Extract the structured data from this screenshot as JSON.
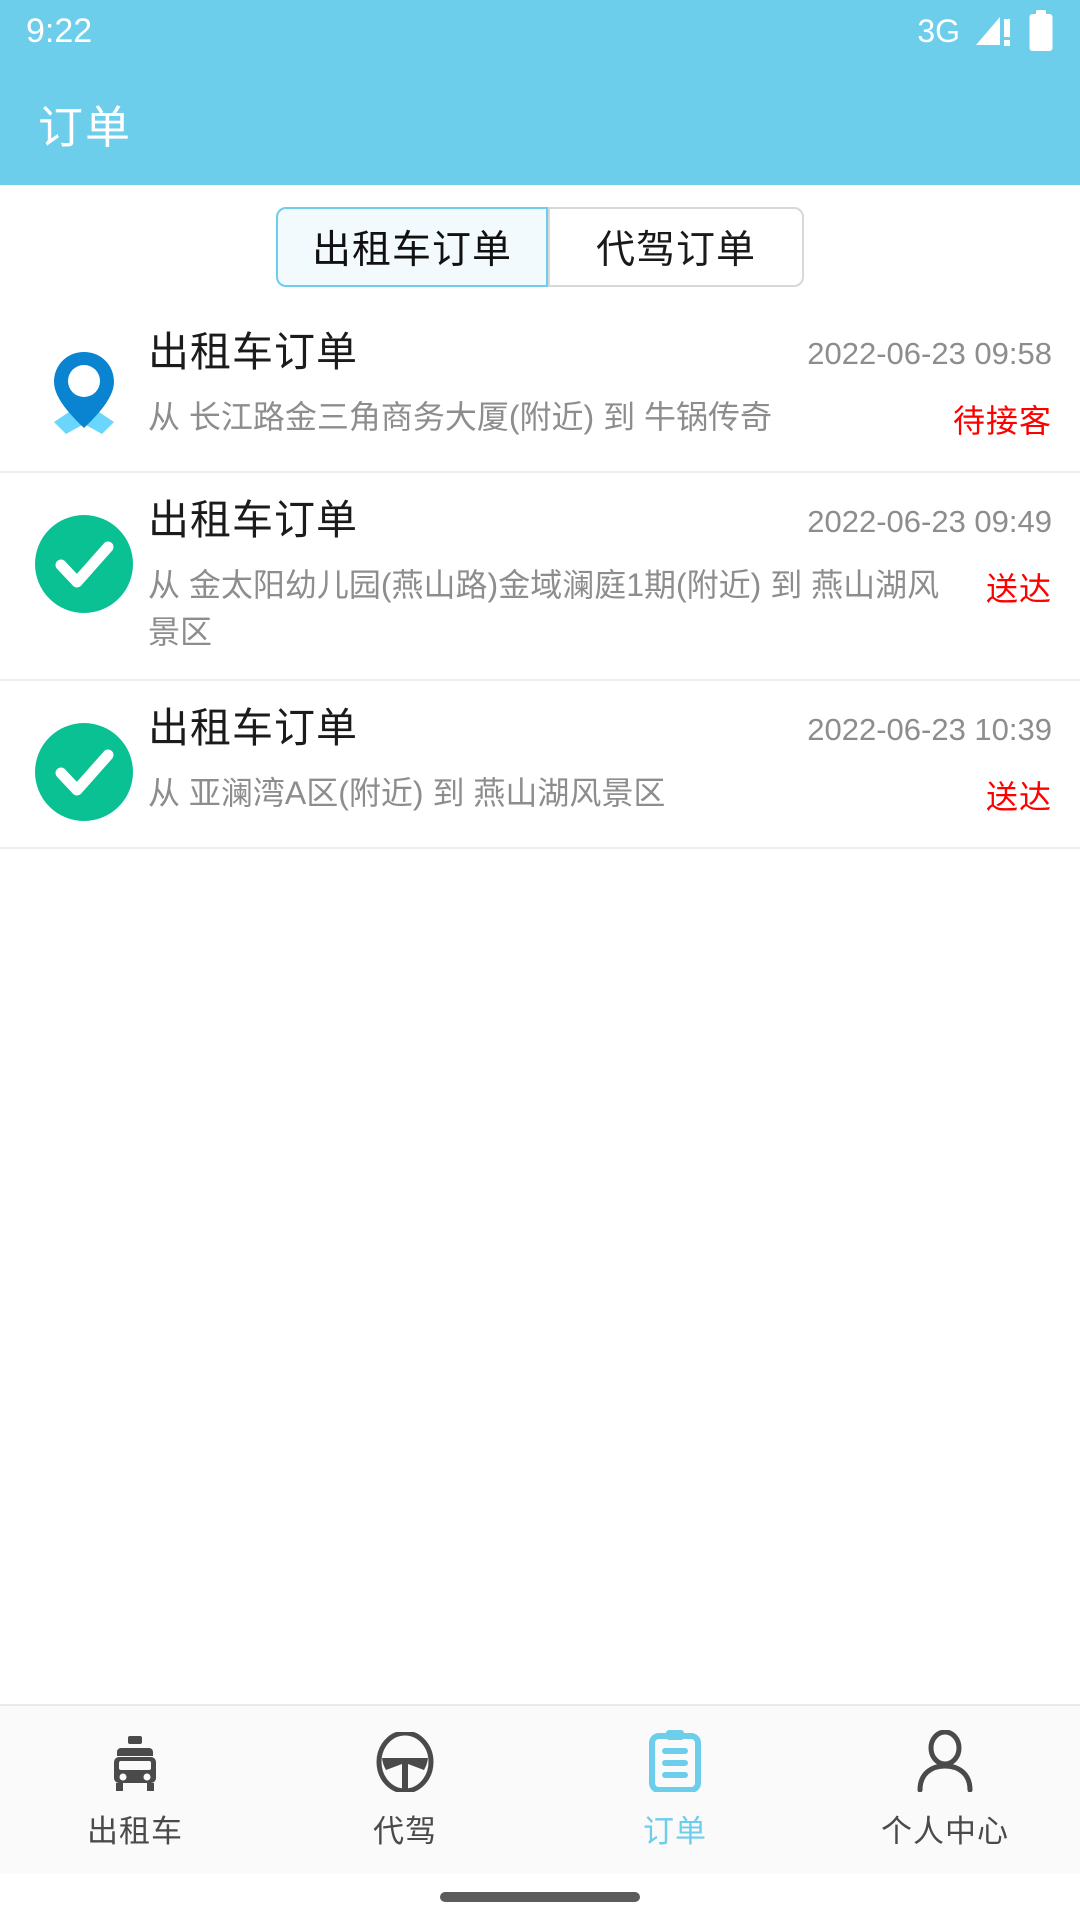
{
  "status_bar": {
    "time": "9:22",
    "network": "3G",
    "icons": [
      "signal-warning-icon",
      "battery-full-icon"
    ]
  },
  "app_bar": {
    "title": "订单"
  },
  "tabs": {
    "active_index": 0,
    "items": [
      {
        "label": "出租车订单",
        "active": true
      },
      {
        "label": "代驾订单",
        "active": false
      }
    ]
  },
  "orders": [
    {
      "icon": "location-pin-icon",
      "title": "出租车订单",
      "time": "2022-06-23 09:58",
      "route": "从 长江路金三角商务大厦(附近) 到 牛锅传奇",
      "status": "待接客",
      "status_color": "#ff0000"
    },
    {
      "icon": "check-circle-icon",
      "title": "出租车订单",
      "time": "2022-06-23 09:49",
      "route": "从 金太阳幼儿园(燕山路)金域澜庭1期(附近) 到 燕山湖风景区",
      "status": "送达",
      "status_color": "#ff0000"
    },
    {
      "icon": "check-circle-icon",
      "title": "出租车订单",
      "time": "2022-06-23 10:39",
      "route": "从 亚澜湾A区(附近) 到 燕山湖风景区",
      "status": "送达",
      "status_color": "#ff0000"
    }
  ],
  "bottom_nav": {
    "active_index": 2,
    "items": [
      {
        "label": "出租车",
        "icon": "taxi-icon",
        "active": false
      },
      {
        "label": "代驾",
        "icon": "steering-wheel-icon",
        "active": false
      },
      {
        "label": "订单",
        "icon": "clipboard-icon",
        "active": true
      },
      {
        "label": "个人中心",
        "icon": "person-icon",
        "active": false
      }
    ]
  },
  "colors": {
    "brand": "#6DCEEC",
    "success": "#0AC193",
    "pin": "#0A84D0",
    "pin_base": "#6BD6FB",
    "status_red": "#ff0000",
    "muted_text": "#8d8d8d"
  }
}
